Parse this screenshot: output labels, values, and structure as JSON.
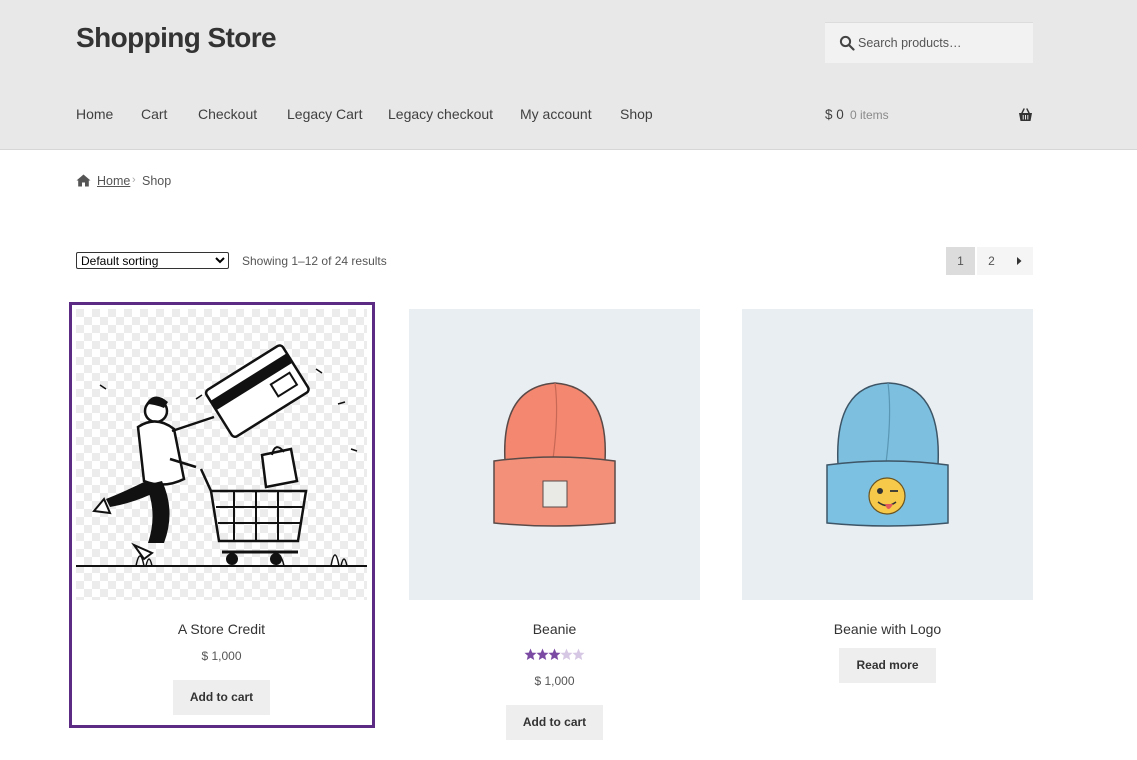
{
  "site": {
    "title": "Shopping Store"
  },
  "search": {
    "placeholder": "Search products…"
  },
  "nav": {
    "items": [
      "Home",
      "Cart",
      "Checkout",
      "Legacy Cart",
      "Legacy checkout",
      "My account",
      "Shop"
    ]
  },
  "cart": {
    "amount": "$ 0",
    "count": "0 items"
  },
  "breadcrumb": {
    "home": "Home",
    "separator": "›",
    "current": "Shop"
  },
  "toolbar": {
    "sorting_selected": "Default sorting",
    "sorting_options": [
      "Default sorting"
    ],
    "result_count": "Showing 1–12 of 24 results"
  },
  "pagination": {
    "pages": [
      "1",
      "2"
    ],
    "current_page": "1",
    "next_icon": "caret-right-icon"
  },
  "products": [
    {
      "name": "A Store Credit",
      "price": "$ 1,000",
      "button": "Add to cart",
      "image": "shopping-cart-illustration"
    },
    {
      "name": "Beanie",
      "price": "$ 1,000",
      "button": "Add to cart",
      "rating": 3.5,
      "image": "orange-beanie"
    },
    {
      "name": "Beanie with Logo",
      "button": "Read more",
      "image": "blue-beanie-with-emoji-logo"
    }
  ],
  "colors": {
    "accent": "#5c2c85",
    "star": "#7b4aa3",
    "header_bg": "#e8e8e8"
  }
}
